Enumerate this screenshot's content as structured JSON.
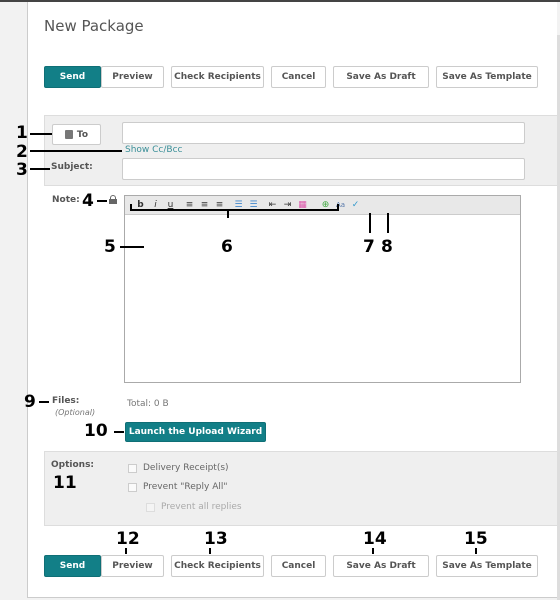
{
  "header": {
    "title": "New Package"
  },
  "actions": {
    "send": "Send",
    "preview": "Preview",
    "check_recipients": "Check Recipients",
    "cancel": "Cancel",
    "save_draft": "Save As Draft",
    "save_template": "Save As Template"
  },
  "address": {
    "to_label": "To",
    "show_cc_bcc": "Show Cc/Bcc",
    "subject_label": "Subject:",
    "to_value": "",
    "subject_value": ""
  },
  "note": {
    "label": "Note:",
    "toolbar": [
      "bold",
      "italic",
      "underline",
      "align-left",
      "align-center",
      "align-right",
      "bullet-list",
      "numbered-list",
      "outdent",
      "indent",
      "text-color",
      "insert-link",
      "spellcheck",
      "check-spelling"
    ],
    "toolbar_glyphs": {
      "bold": "b",
      "italic": "i",
      "underline": "u"
    }
  },
  "files": {
    "label": "Files:",
    "optional": "(Optional)",
    "total": "Total: 0 B",
    "upload_button": "Launch the Upload Wizard"
  },
  "options": {
    "label": "Options:",
    "items": [
      {
        "label": "Delivery Receipt(s)",
        "checked": false
      },
      {
        "label": "Prevent \"Reply All\"",
        "checked": false
      },
      {
        "label": "Prevent all replies",
        "checked": false,
        "disabled": true
      }
    ]
  },
  "callouts": [
    "1",
    "2",
    "3",
    "4",
    "5",
    "6",
    "7",
    "8",
    "9",
    "10",
    "11",
    "12",
    "13",
    "14",
    "15"
  ],
  "colors": {
    "primary": "#127f87",
    "link": "#3a8f98"
  }
}
